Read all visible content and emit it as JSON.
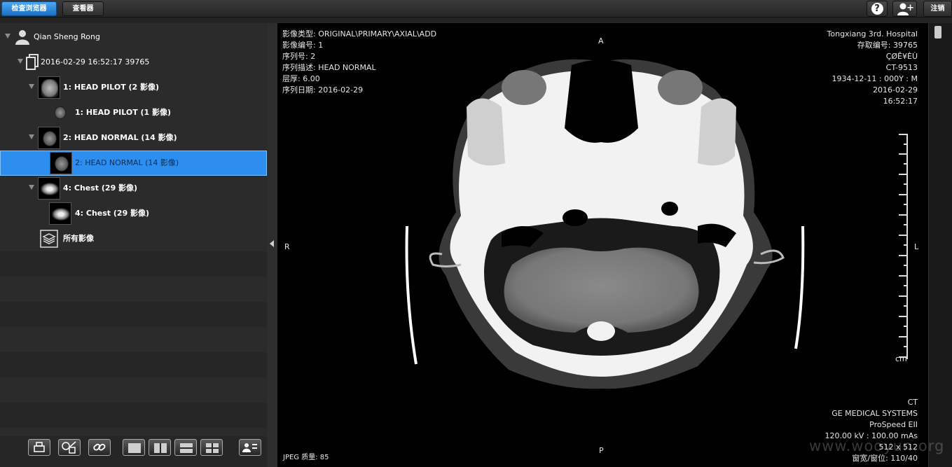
{
  "topbar": {
    "tab_browser": "检查浏览器",
    "tab_viewer": "查看器",
    "help_label": "?",
    "add_user_label": "+",
    "logout_label": "注销"
  },
  "tree": {
    "patient": "Qian Sheng Rong",
    "study": "2016-02-29 16:52:17 39765",
    "series1": "1: HEAD PILOT (2 影像)",
    "series1_child": "1: HEAD PILOT (1 影像)",
    "series2": "2: HEAD NORMAL (14 影像)",
    "series2_child": "2: HEAD NORMAL (14 影像)",
    "series4": "4: Chest (29 影像)",
    "series4_child": "4: Chest (29 影像)",
    "all_images": "所有影像"
  },
  "overlay": {
    "top_left": [
      "影像类型: ORIGINAL\\PRIMARY\\AXIAL\\ADD",
      "影像编号: 1",
      "序列号: 2",
      "序列描述: HEAD NORMAL",
      "层厚: 6.00",
      "序列日期: 2016-02-29"
    ],
    "top_right": [
      "Tongxiang 3rd. Hospital",
      "存取编号: 39765",
      "ÇØÊ¥ÈÙ",
      "CT-9513",
      "1934-12-11 : 000Y : M",
      "2016-02-29",
      "16:52:17"
    ],
    "bottom_right": [
      "CT",
      "GE MEDICAL SYSTEMS",
      "ProSpeed EII",
      "120.00 kV : 100.00 mAs",
      "512 x 512",
      "窗宽/窗位: 110/40"
    ],
    "bottom_left": "JPEG 质量: 85",
    "orient_top": "A",
    "orient_bottom": "P",
    "orient_left": "R",
    "orient_right": "L",
    "ruler_unit": "cm"
  },
  "watermark": "www.wooyun.org"
}
